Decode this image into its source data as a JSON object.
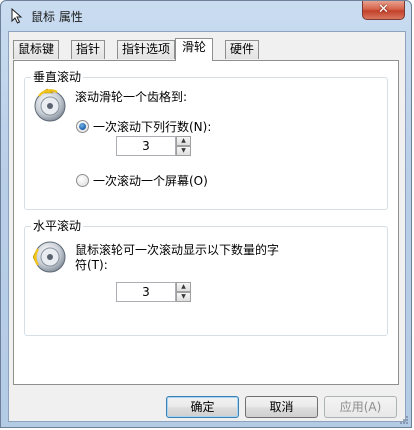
{
  "window": {
    "title": "鼠标 属性",
    "close_glyph": "✕"
  },
  "tabs": [
    {
      "label": "鼠标键",
      "active": false
    },
    {
      "label": "指针",
      "active": false
    },
    {
      "label": "指针选项",
      "active": false
    },
    {
      "label": "滑轮",
      "active": true
    },
    {
      "label": "硬件",
      "active": false
    }
  ],
  "vertical_scroll": {
    "group_title": "垂直滚动",
    "prompt": "滚动滑轮一个齿格到:",
    "option_lines_label": "一次滚动下列行数(N):",
    "option_lines_checked": true,
    "lines_value": "3",
    "option_screen_label": "一次滚动一个屏幕(O)",
    "option_screen_checked": false
  },
  "horizontal_scroll": {
    "group_title": "水平滚动",
    "prompt_line1": "鼠标滚轮可一次滚动显示以下数量的字",
    "prompt_line2": "符(T):",
    "chars_value": "3"
  },
  "buttons": {
    "ok": "确定",
    "cancel": "取消",
    "apply": "应用(A)"
  },
  "icons": {
    "title": "mouse-pointer-icon",
    "wheel": "mouse-wheel-icon",
    "spin_up": "▲",
    "spin_down": "▼"
  }
}
